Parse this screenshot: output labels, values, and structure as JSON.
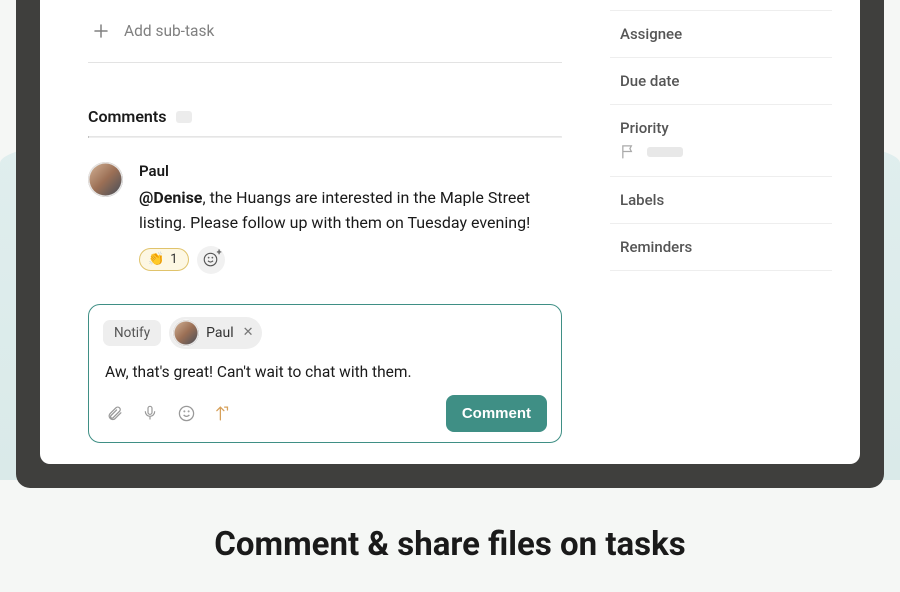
{
  "add_subtask_label": "Add sub-task",
  "comments_label": "Comments",
  "comment": {
    "author": "Paul",
    "mention": "@Denise",
    "text_after_mention": ", the Huangs are interested in the Maple Street listing. Please follow up with them on Tuesday evening!",
    "reaction_emoji": "👏",
    "reaction_count": "1"
  },
  "compose": {
    "notify_label": "Notify",
    "notify_user": "Paul",
    "draft_text": "Aw, that's great! Can't wait to chat with them.",
    "submit_label": "Comment"
  },
  "sidebar": {
    "assignee": "Assignee",
    "due_date": "Due date",
    "priority": "Priority",
    "labels": "Labels",
    "reminders": "Reminders"
  },
  "page_headline": "Comment & share files on tasks"
}
